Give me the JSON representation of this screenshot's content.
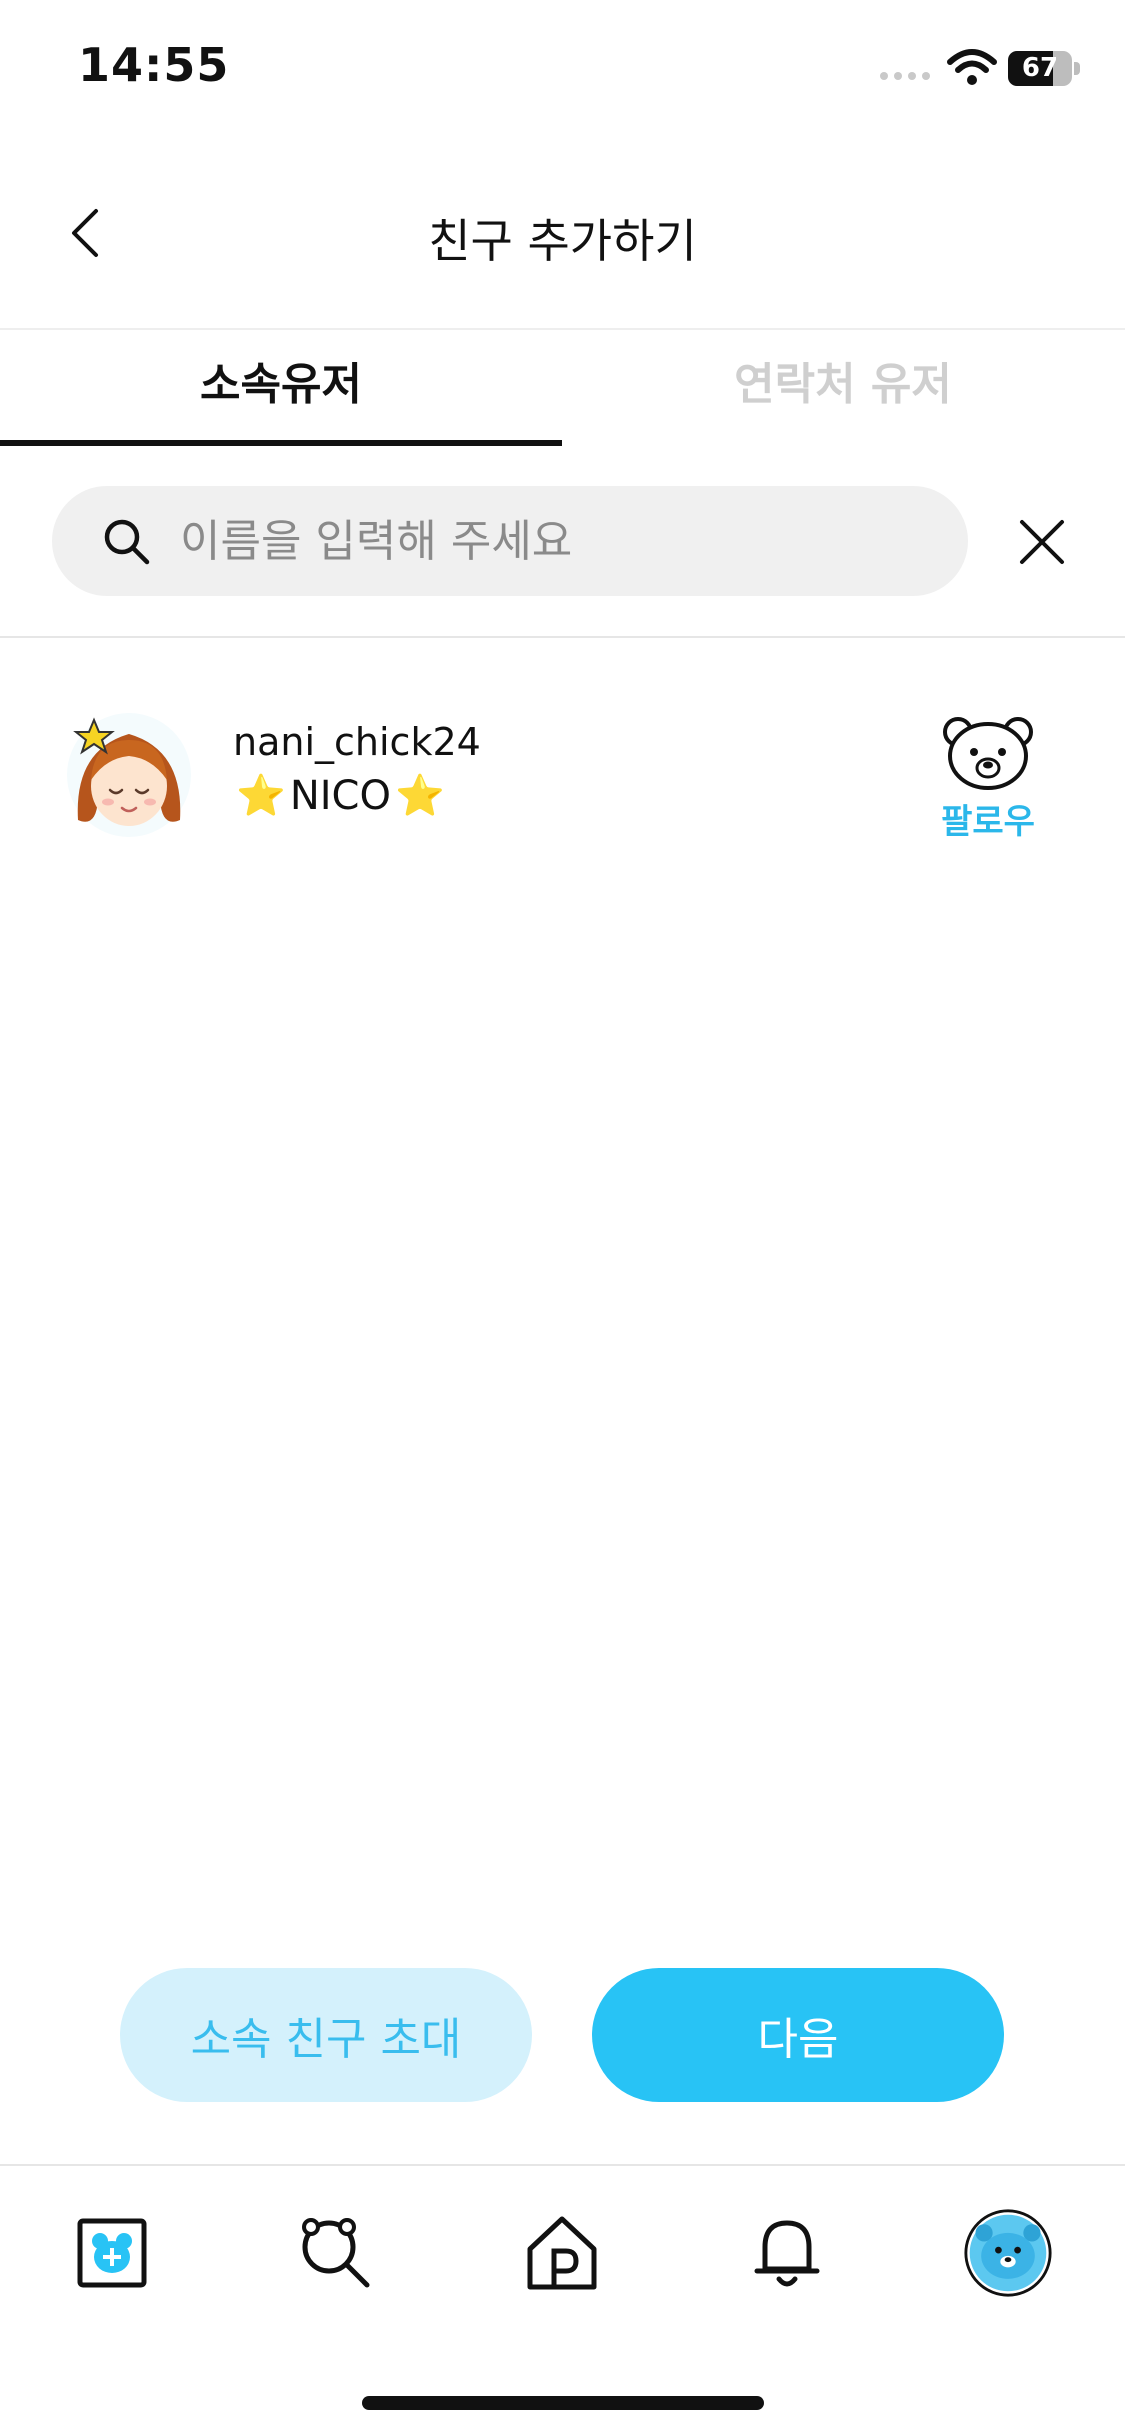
{
  "status_bar": {
    "time": "14:55",
    "battery": "67"
  },
  "header": {
    "title": "친구 추가하기"
  },
  "tabs": [
    {
      "label": "소속유저",
      "active": true
    },
    {
      "label": "연락처 유저",
      "active": false
    }
  ],
  "search": {
    "placeholder": "이름을 입력해 주세요",
    "value": ""
  },
  "users": [
    {
      "username": "nani_chick24",
      "nickname": "NICO",
      "nickname_decoration": "⭐",
      "action_label": "팔로우"
    }
  ],
  "buttons": {
    "invite": "소속 친구 초대",
    "next": "다음"
  },
  "colors": {
    "accent": "#28c3f5",
    "accent_light": "#d4f1fc",
    "follow_text": "#2bb7ea"
  },
  "bottom_nav": [
    {
      "icon": "add-post-icon"
    },
    {
      "icon": "search-icon"
    },
    {
      "icon": "home-icon"
    },
    {
      "icon": "bell-icon"
    },
    {
      "icon": "profile-avatar-icon"
    }
  ]
}
